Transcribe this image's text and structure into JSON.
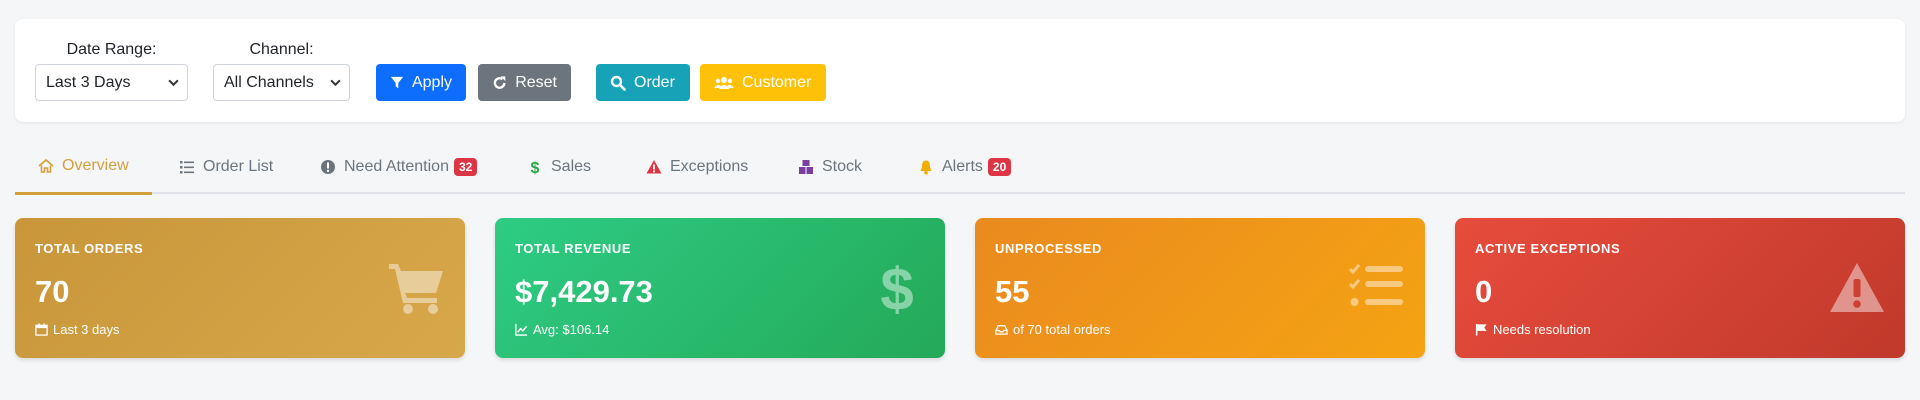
{
  "filters": {
    "date_range": {
      "label": "Date Range:",
      "selected": "Last 3 Days"
    },
    "channel": {
      "label": "Channel:",
      "selected": "All Channels"
    },
    "apply_label": "Apply",
    "reset_label": "Reset",
    "order_label": "Order",
    "customer_label": "Customer"
  },
  "tabs": [
    {
      "label": "Overview",
      "icon": "home-icon",
      "active": true
    },
    {
      "label": "Order List",
      "icon": "list-icon"
    },
    {
      "label": "Need Attention",
      "icon": "exclamation-circle-icon",
      "badge": "32"
    },
    {
      "label": "Sales",
      "icon": "dollar-icon"
    },
    {
      "label": "Exceptions",
      "icon": "warning-icon"
    },
    {
      "label": "Stock",
      "icon": "boxes-icon"
    },
    {
      "label": "Alerts",
      "icon": "bell-icon",
      "badge": "20"
    }
  ],
  "kpis": [
    {
      "title": "TOTAL ORDERS",
      "value": "70",
      "sub": "Last 3 days",
      "icon": "cart-icon"
    },
    {
      "title": "TOTAL REVENUE",
      "value": "$7,429.73",
      "sub": "Avg: $106.14",
      "icon": "dollar-icon"
    },
    {
      "title": "UNPROCESSED",
      "value": "55",
      "sub": "of 70 total orders",
      "icon": "tasks-icon"
    },
    {
      "title": "ACTIVE EXCEPTIONS",
      "value": "0",
      "sub": "Needs resolution",
      "icon": "warning-icon"
    }
  ],
  "colors": {
    "primary": "#0d6efd",
    "secondary": "#6c757d",
    "info": "#17a2b8",
    "warning": "#ffc107",
    "tab_active": "#d4a03a",
    "badge": "#dc3545"
  }
}
